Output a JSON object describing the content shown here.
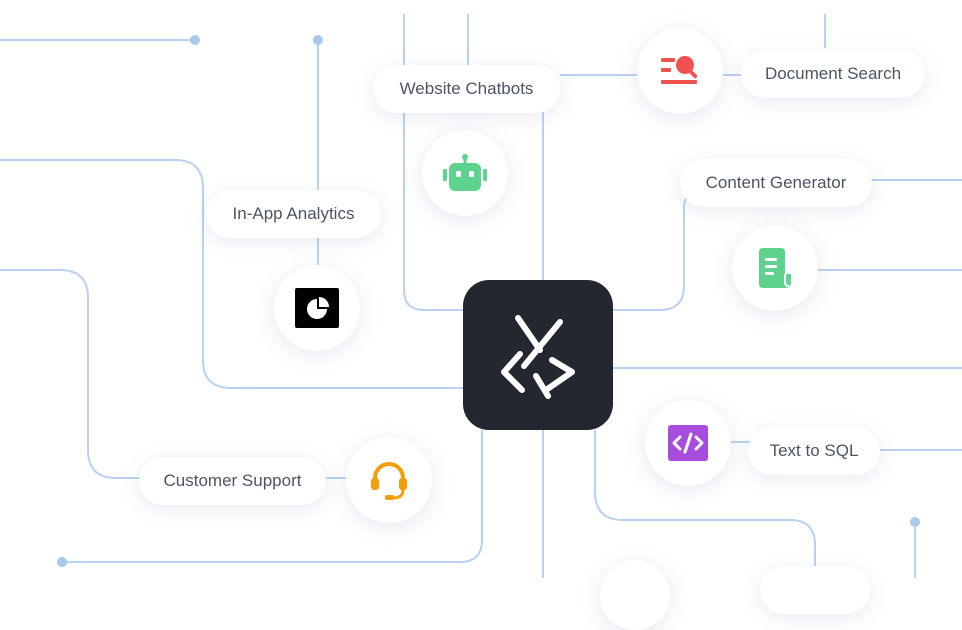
{
  "nodes": {
    "website_chatbots": {
      "label": "Website Chatbots",
      "icon": "robot-icon",
      "color": "#5fd38d"
    },
    "document_search": {
      "label": "Document Search",
      "icon": "document-search-icon",
      "color": "#f0534f"
    },
    "in_app_analytics": {
      "label": "In-App Analytics",
      "icon": "pie-chart-icon",
      "color": "#000000"
    },
    "content_generator": {
      "label": "Content Generator",
      "icon": "document-icon",
      "color": "#5fd38d"
    },
    "customer_support": {
      "label": "Customer Support",
      "icon": "headset-icon",
      "color": "#f59e0b"
    },
    "text_to_sql": {
      "label": "Text to SQL",
      "icon": "code-icon",
      "color": "#a64de0"
    }
  },
  "hub": {
    "icon": "brand-logo-icon",
    "color": "#23272f"
  },
  "colors": {
    "line": "#b8d2f0",
    "dot": "#a9c8ec"
  }
}
